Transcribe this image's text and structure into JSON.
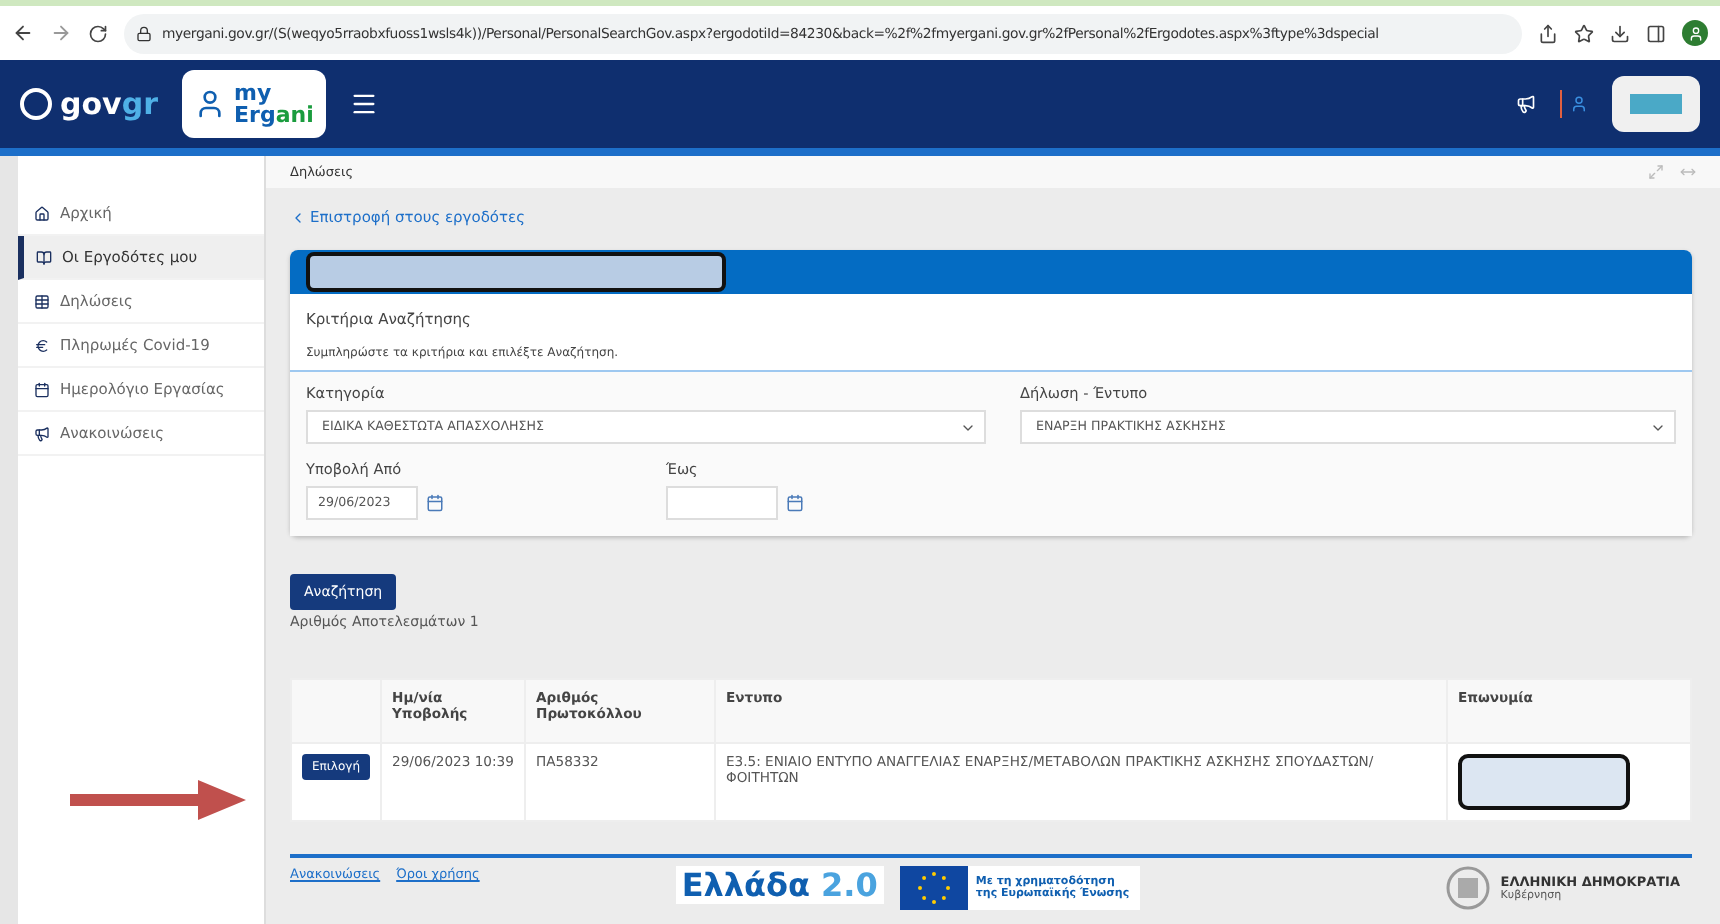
{
  "browser": {
    "url": "myergani.gov.gr/(S(weqyo5rraobxfuoss1wsls4k))/Personal/PersonalSearchGov.aspx?ergodotiId=84230&back=%2f%2fmyergani.gov.gr%2fPersonal%2fErgodotes.aspx%3ftype%3dspecial"
  },
  "header": {
    "brand": "gov",
    "brand_accent": "gr",
    "app_top": "my",
    "app_name": "Ergani"
  },
  "breadcrumb": "Δηλώσεις",
  "sidebar": {
    "items": [
      {
        "label": "Αρχική",
        "selected": false
      },
      {
        "label": "Οι Εργοδότες μου",
        "selected": true
      },
      {
        "label": "Δηλώσεις",
        "selected": false
      },
      {
        "label": "Πληρωμές Covid-19",
        "selected": false
      },
      {
        "label": "Ημερολόγιο Εργασίας",
        "selected": false
      },
      {
        "label": "Ανακοινώσεις",
        "selected": false
      }
    ]
  },
  "back_link": "Επιστροφή στους εργοδότες",
  "search_panel": {
    "title": "Κριτήρια Αναζήτησης",
    "hint": "Συμπληρώστε τα κριτήρια και επιλέξτε Αναζήτηση.",
    "category": {
      "label": "Κατηγορία",
      "value": "ΕΙΔΙΚΑ ΚΑΘΕΣΤΩΤΑ ΑΠΑΣΧΟΛΗΣΗΣ"
    },
    "form": {
      "label": "Δήλωση - Έντυπο",
      "value": "ΕΝΑΡΞΗ ΠΡΑΚΤΙΚΗΣ ΑΣΚΗΣΗΣ"
    },
    "date_from": {
      "label": "Υποβολή Από",
      "value": "29/06/2023"
    },
    "date_to": {
      "label": "Έως"
    }
  },
  "search_button": "Αναζήτηση",
  "results_count": "Αριθμός Αποτελεσμάτων 1",
  "table": {
    "columns": [
      "Ημ/νία Υποβολής",
      "Αριθμός Πρωτοκόλλου",
      "Εντυπο",
      "Επωνυμία"
    ],
    "rows": [
      {
        "action": "Επιλογή",
        "date": "29/06/2023 10:39",
        "protocol": "ΠΑ58332",
        "form": "Ε3.5: ΕΝΙΑΙΟ ΕΝΤΥΠΟ ΑΝΑΓΓΕΛΙΑΣ ΕΝΑΡΞΗΣ/ΜΕΤΑΒΟΛΩΝ ΠΡΑΚΤΙΚΗΣ ΑΣΚΗΣΗΣ ΣΠΟΥΔΑΣΤΩΝ/ ΦΟΙΤΗΤΩΝ"
      }
    ]
  },
  "footer": {
    "links": [
      "Ανακοινώσεις",
      "Όροι χρήσης"
    ],
    "greece_logo": "Ελλάδα",
    "greece_version": "2.0",
    "eu_text": "Με τη χρηματοδότηση της Ευρωπαϊκής Ένωσης",
    "gov_title": "ΕΛΛΗΝΙΚΗ ΔΗΜΟΚΡΑΤΙΑ",
    "gov_sub": "Κυβέρνηση"
  }
}
